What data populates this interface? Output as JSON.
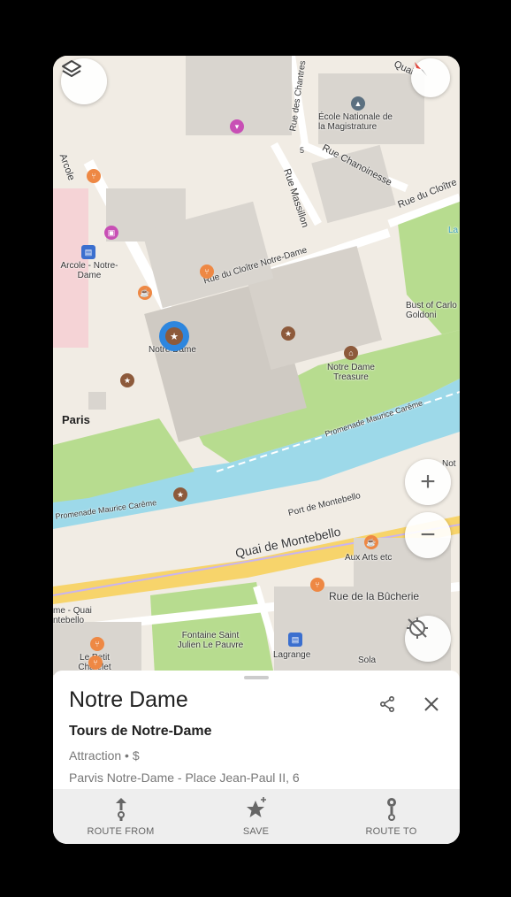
{
  "map": {
    "labels": {
      "arcole": "Arcole - Notre-Dame",
      "notre_dame": "Notre Dame",
      "treasure": "Notre Dame Treasure",
      "paris": "Paris",
      "ecole": "École Nationale de la Magistrature",
      "bust": "Bust of Carlo Goldoni",
      "aux_arts": "Aux Arts etc",
      "fontaine": "Fontaine Saint Julien Le Pauvre",
      "lagrange": "Lagrange",
      "petit_chatelet": "Le Petit Châtelet",
      "sola": "Sola",
      "quai_montebello_stop": "me - Quai ntebello",
      "la": "La",
      "not": "Not"
    },
    "streets": {
      "quai_montebello": "Quai de Montebello",
      "port_montebello": "Port de Montebello",
      "rue_bucherie": "Rue de la Bûcherie",
      "rue_cloitre_nd": "Rue du Cloître Notre-Dame",
      "rue_massillon": "Rue Massillon",
      "rue_chanoinesse": "Rue Chanoinesse",
      "rue_cloitre": "Rue du Cloître",
      "rue_chantres": "Rue des Chantres",
      "prom_left": "Promenade Maurice Carême",
      "prom_right": "Promenade Maurice Carême",
      "quai_top": "Quai",
      "arcole_street": "Arcole",
      "num_5": "5"
    },
    "colors": {
      "water": "#9dd9e9",
      "park": "#b7dc8f",
      "building": "#d9d5cf",
      "road": "#ffffff",
      "main_road": "#f7d46b",
      "poi_brown": "#8d5a3b",
      "poi_orange": "#ee8844",
      "selected": "#2e86de"
    }
  },
  "controls": {
    "layers_icon": "layers-icon",
    "zoom_in": "+",
    "zoom_out": "−",
    "location_icon": "location-off-icon",
    "compass_icon": "compass-icon"
  },
  "place": {
    "name": "Notre Dame",
    "subtitle": "Tours de Notre-Dame",
    "category": "Attraction • $",
    "address": "Parvis Notre-Dame - Place Jean-Paul II, 6"
  },
  "actions": {
    "route_from": "ROUTE FROM",
    "save": "SAVE",
    "route_to": "ROUTE TO"
  }
}
